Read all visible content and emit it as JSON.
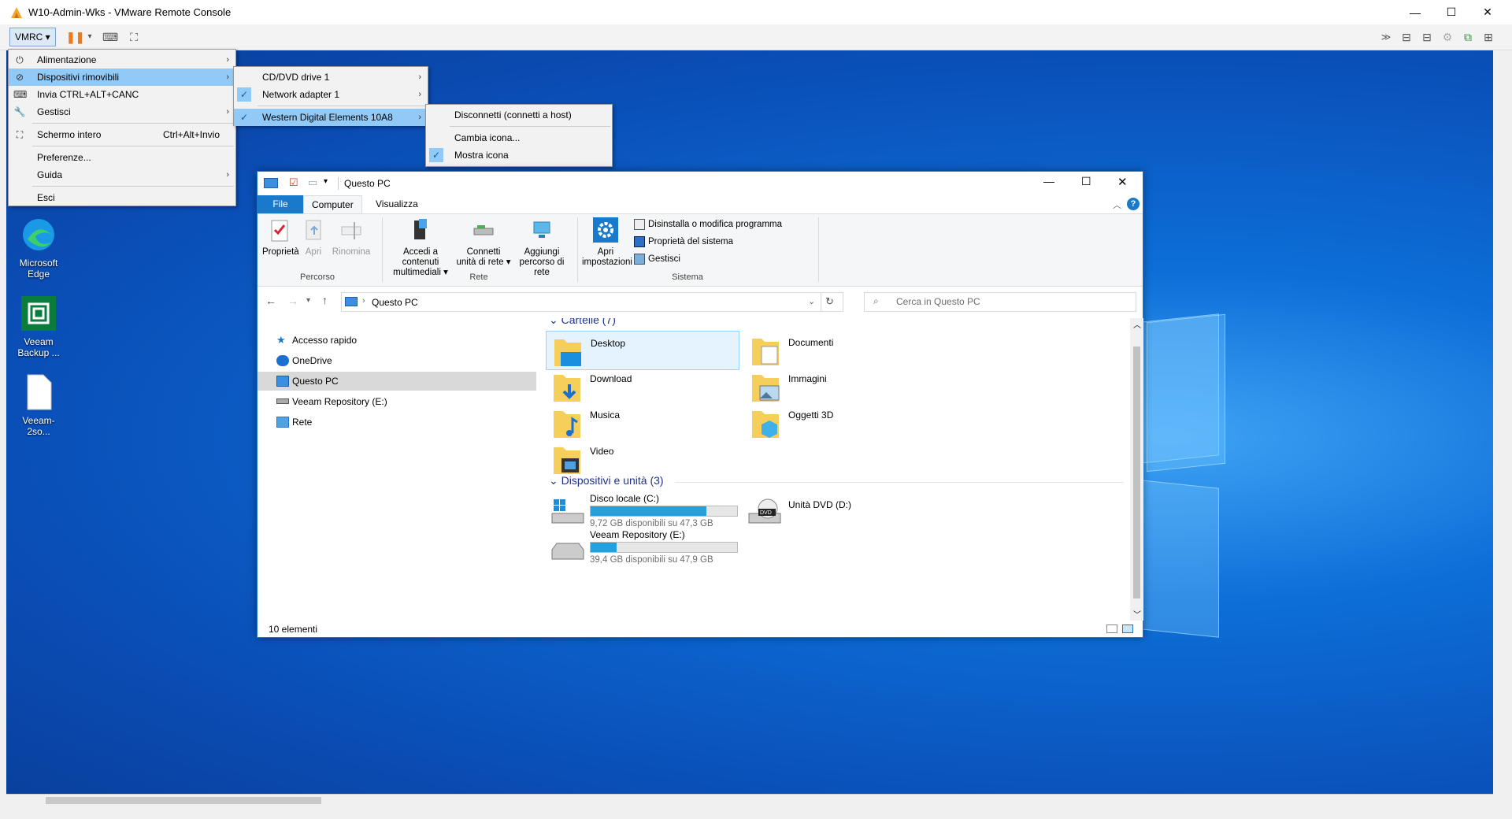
{
  "window": {
    "title": "W10-Admin-Wks - VMware Remote Console"
  },
  "toolbar": {
    "vmrc_label": "VMRC ▾"
  },
  "menus": {
    "main": [
      {
        "label": "Alimentazione",
        "icon": "power-icon",
        "submenu": true
      },
      {
        "label": "Dispositivi rimovibili",
        "icon": "removable-device-icon",
        "submenu": true,
        "highlighted": true
      },
      {
        "label": "Invia CTRL+ALT+CANC",
        "icon": "keyboard-icon"
      },
      {
        "label": "Gestisci",
        "icon": "wrench-icon",
        "submenu": true
      },
      {
        "label": "Schermo intero",
        "icon": "fullscreen-icon",
        "shortcut": "Ctrl+Alt+Invio"
      },
      {
        "label": "Preferenze..."
      },
      {
        "label": "Guida",
        "submenu": true
      },
      {
        "label": "Esci"
      }
    ],
    "devices": [
      {
        "label": "CD/DVD drive 1",
        "checked": false,
        "submenu": true
      },
      {
        "label": "Network adapter 1",
        "checked": true,
        "submenu": true
      },
      {
        "label": "Western Digital Elements 10A8",
        "checked": true,
        "submenu": true,
        "highlighted": true
      }
    ],
    "device_actions": [
      {
        "label": "Disconnetti (connetti a host)"
      },
      {
        "label": "Cambia icona..."
      },
      {
        "label": "Mostra icona",
        "checked": true
      }
    ]
  },
  "desktop": {
    "icons": [
      {
        "label": "Microsoft Edge",
        "icon": "edge-icon"
      },
      {
        "label": "Veeam Backup ...",
        "icon": "veeam-icon"
      },
      {
        "label": "Veeam-2so...",
        "icon": "file-icon"
      }
    ]
  },
  "explorer": {
    "title": "Questo PC",
    "tabs": [
      "File",
      "Computer",
      "Visualizza"
    ],
    "ribbon": {
      "groups": [
        "Percorso",
        "Rete",
        "Sistema"
      ],
      "buttons": {
        "proprieta": "Proprietà",
        "apri": "Apri",
        "rinomina": "Rinomina",
        "accedi": "Accedi a contenuti multimediali ▾",
        "connetti": "Connetti unità di rete ▾",
        "aggiungi": "Aggiungi percorso di rete",
        "impostazioni": "Apri impostazioni"
      },
      "small": [
        "Disinstalla o modifica programma",
        "Proprietà del sistema",
        "Gestisci"
      ]
    },
    "address": "Questo PC",
    "search_placeholder": "Cerca in Questo PC",
    "nav": [
      "Accesso rapido",
      "OneDrive",
      "Questo PC",
      "Veeam Repository (E:)",
      "Rete"
    ],
    "folders_heading": "Cartelle (7)",
    "folders": [
      "Desktop",
      "Documenti",
      "Download",
      "Immagini",
      "Musica",
      "Oggetti 3D",
      "Video"
    ],
    "devices_heading": "Dispositivi e unità (3)",
    "drives": [
      {
        "name": "Disco locale (C:)",
        "free": "9,72 GB disponibili su 47,3 GB",
        "used_fraction": 0.79
      },
      {
        "name": "Unità DVD (D:)"
      },
      {
        "name": "Veeam Repository (E:)",
        "free": "39,4 GB disponibili su 47,9 GB",
        "used_fraction": 0.18
      }
    ],
    "status": "10 elementi"
  }
}
